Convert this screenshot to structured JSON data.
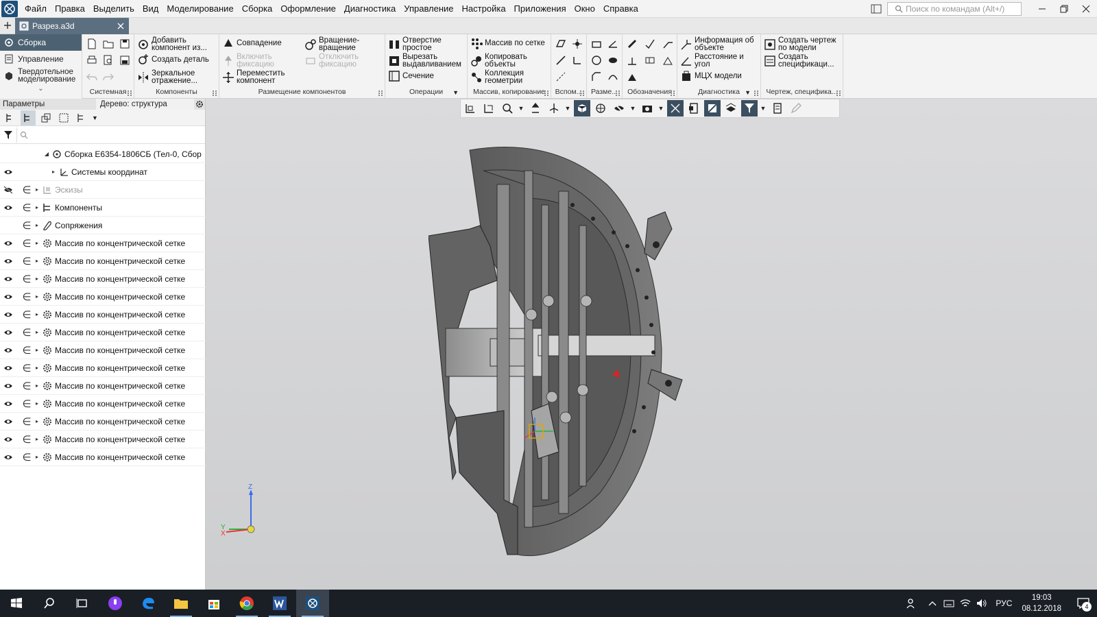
{
  "menu": {
    "items": [
      "Файл",
      "Правка",
      "Выделить",
      "Вид",
      "Моделирование",
      "Сборка",
      "Оформление",
      "Диагностика",
      "Управление",
      "Настройка",
      "Приложения",
      "Окно",
      "Справка"
    ],
    "search_placeholder": "Поиск по командам (Alt+/)"
  },
  "doc_tab": {
    "title": "Разрез.a3d"
  },
  "ribbon": {
    "modes": [
      "Сборка",
      "Управление",
      "Твердотельное моделирование"
    ],
    "groups": {
      "system": "Системная",
      "components": "Компоненты",
      "placement": "Размещение компонентов",
      "operations": "Операции",
      "array_copy": "Массив, копирование",
      "aux": "Вспом...",
      "dims": "Разме...",
      "designations": "Обозначения",
      "diagnostics": "Диагностика",
      "drawing_spec": "Чертеж, специфика..."
    },
    "buttons": {
      "add_component": "Добавить компонент из...",
      "create_part": "Создать деталь",
      "mirror": "Зеркальное отражение...",
      "coincidence": "Совпадение",
      "rotation": "Вращение-вращение",
      "enable_fix": "Включить фиксацию",
      "disable_fix": "Отключить фиксацию",
      "move_component": "Переместить компонент",
      "hole_simple": "Отверстие простое",
      "cut_extrude": "Вырезать выдавливанием",
      "section": "Сечение",
      "grid_array": "Массив по сетке",
      "copy_objects": "Копировать объекты",
      "geometry_collection": "Коллекция геометрии",
      "object_info": "Информация об объекте",
      "distance_angle": "Расстояние и угол",
      "mass_props": "МЦХ модели",
      "create_drawing": "Создать чертеж по модели",
      "create_spec": "Создать спецификаци..."
    }
  },
  "panel": {
    "params_title": "Параметры",
    "tree_title": "Дерево: структура",
    "tree": {
      "root": "Сборка Е6354-1806СБ (Тел-0, Сбор",
      "coords": "Системы координат",
      "sketches": "Эскизы",
      "components": "Компоненты",
      "mates": "Сопряжения",
      "array_label": "Массив по концентрической сетке",
      "array_rows": [
        "1",
        "2",
        "3",
        "4",
        "5",
        "6",
        "7",
        "8",
        "9",
        "10",
        "11",
        "12",
        "13"
      ]
    }
  },
  "triad": {
    "x": "X",
    "y": "Y",
    "z": "Z"
  },
  "colors": {
    "accent": "#4c6273",
    "taskbar": "#1a1f26",
    "model": "#6e6e6e"
  },
  "taskbar": {
    "apps": [
      "start-icon",
      "search-icon",
      "task-view-icon",
      "cortana-icon",
      "edge-icon",
      "explorer-icon",
      "store-icon",
      "chrome-icon",
      "word-icon",
      "kompas-icon"
    ],
    "lang": "РУС",
    "time": "19:03",
    "date": "08.12.2018",
    "notifications": "4"
  }
}
